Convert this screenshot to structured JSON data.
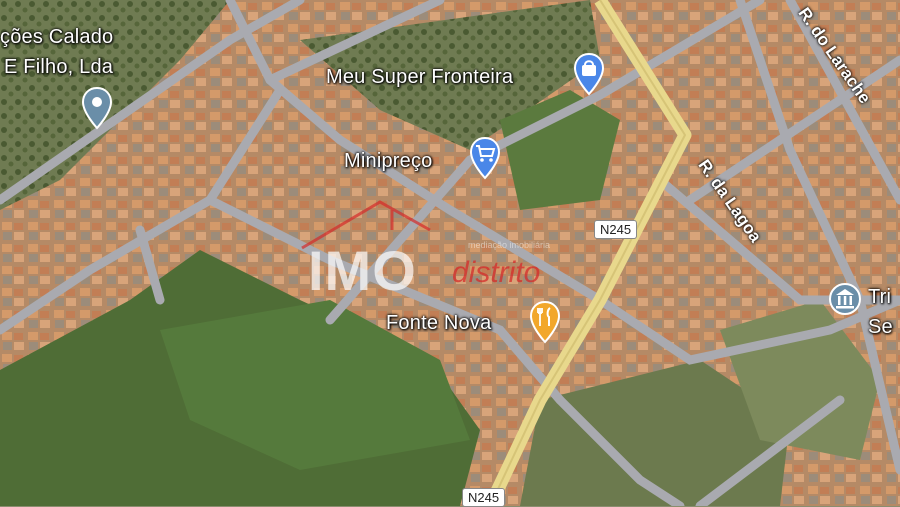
{
  "map": {
    "colors": {
      "road": "#a9aab0",
      "highway": "#e8d88c",
      "field_dark": "#4d6a35",
      "roof": "#c98c5e",
      "marker_blue": "#4a87e8",
      "marker_grey": "#6a8ea8",
      "marker_orange": "#f2a72b"
    },
    "places": {
      "calado_line1": "ções Calado",
      "calado_line2": "E Filho, Lda",
      "meu_super": "Meu Super Fronteira",
      "minipreco": "Minipreço",
      "fonte_nova": "Fonte Nova",
      "tribunal_line1": "Tri",
      "tribunal_line2": "Se"
    },
    "roads": {
      "r_larache": "R. do Larache",
      "r_lagoa": "R. da Lagoa",
      "n245_upper": "N245",
      "n245_lower": "N245"
    },
    "icons": {
      "calado": "location-pin-icon",
      "meu_super": "shopping-bag-icon",
      "minipreco": "shopping-cart-icon",
      "fonte_nova": "restaurant-icon",
      "tribunal": "government-building-icon"
    }
  },
  "watermark": {
    "brand": "IMO",
    "suffix": "distrito",
    "tagline": "mediação imobiliária"
  }
}
